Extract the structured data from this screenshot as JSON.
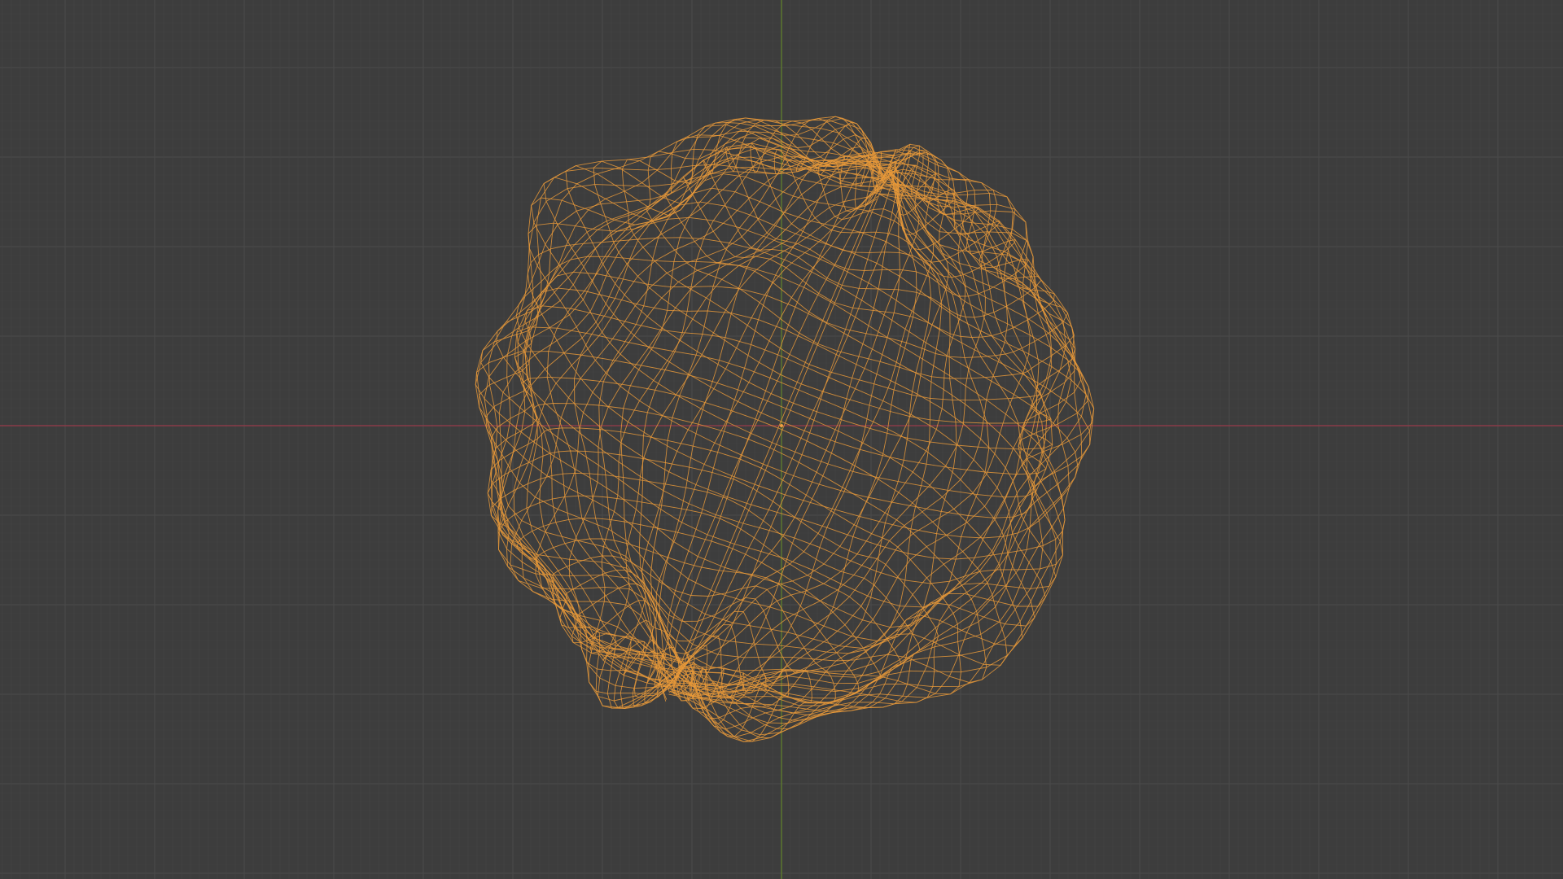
{
  "viewport": {
    "mode": "wireframe",
    "object": "deformed-sphere-mesh",
    "colors": {
      "background": "#3d3d3d",
      "grid_minor": "#454545",
      "grid_major": "#4a4a4a",
      "x_axis": "#8a3b48",
      "y_axis": "#5d7a2e",
      "wire": "#e8993a",
      "origin": "#f0a040"
    }
  }
}
